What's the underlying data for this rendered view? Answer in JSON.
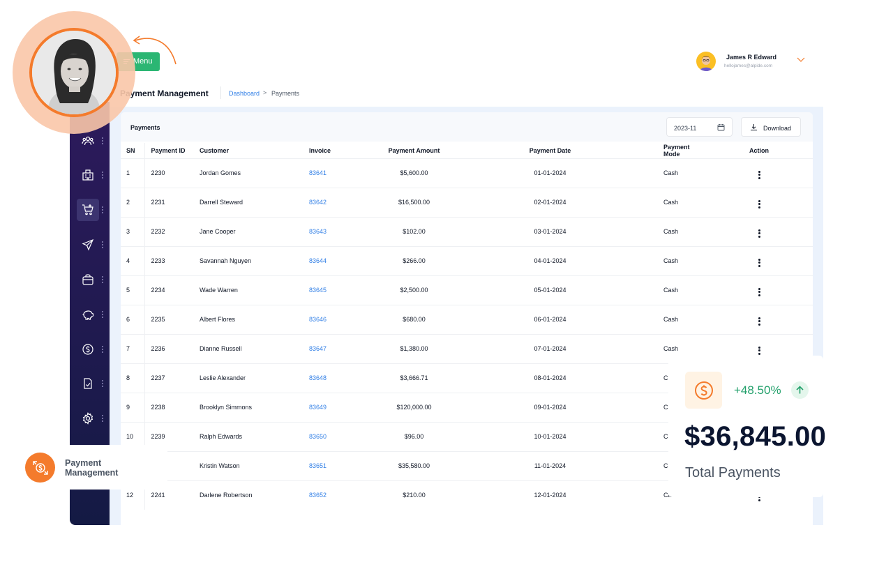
{
  "header": {
    "menu_label": "Menu",
    "page_title": "Payment Management",
    "breadcrumb": [
      "Dashboard",
      ">",
      "Payments"
    ],
    "user": {
      "name": "James R Edward",
      "email": "hellojames@alpide.com"
    }
  },
  "sidebar": {
    "items": [
      {
        "icon": "users-icon"
      },
      {
        "icon": "building-icon"
      },
      {
        "icon": "cart-icon",
        "active": true
      },
      {
        "icon": "send-icon"
      },
      {
        "icon": "bag-icon"
      },
      {
        "icon": "piggy-bank-icon"
      },
      {
        "icon": "dollar-circle-icon"
      },
      {
        "icon": "document-check-icon"
      },
      {
        "icon": "settings-icon"
      }
    ]
  },
  "payments": {
    "title": "Payments",
    "period": "2023-11",
    "download_label": "Download",
    "columns": [
      "SN",
      "Payment ID",
      "Customer",
      "Invoice",
      "Payment Amount",
      "Payment Date",
      "Payment Mode",
      "Action"
    ],
    "rows": [
      {
        "sn": "1",
        "pid": "2230",
        "customer": "Jordan Gomes",
        "invoice": "83641",
        "amount": "$5,600.00",
        "date": "01-01-2024",
        "mode": "Cash"
      },
      {
        "sn": "2",
        "pid": "2231",
        "customer": "Darrell Steward",
        "invoice": "83642",
        "amount": "$16,500.00",
        "date": "02-01-2024",
        "mode": "Cash"
      },
      {
        "sn": "3",
        "pid": "2232",
        "customer": "Jane Cooper",
        "invoice": "83643",
        "amount": "$102.00",
        "date": "03-01-2024",
        "mode": "Cash"
      },
      {
        "sn": "4",
        "pid": "2233",
        "customer": "Savannah Nguyen",
        "invoice": "83644",
        "amount": "$266.00",
        "date": "04-01-2024",
        "mode": "Cash"
      },
      {
        "sn": "5",
        "pid": "2234",
        "customer": "Wade Warren",
        "invoice": "83645",
        "amount": "$2,500.00",
        "date": "05-01-2024",
        "mode": "Cash"
      },
      {
        "sn": "6",
        "pid": "2235",
        "customer": "Albert Flores",
        "invoice": "83646",
        "amount": "$680.00",
        "date": "06-01-2024",
        "mode": "Cash"
      },
      {
        "sn": "7",
        "pid": "2236",
        "customer": "Dianne Russell",
        "invoice": "83647",
        "amount": "$1,380.00",
        "date": "07-01-2024",
        "mode": "Cash"
      },
      {
        "sn": "8",
        "pid": "2237",
        "customer": "Leslie Alexander",
        "invoice": "83648",
        "amount": "$3,666.71",
        "date": "08-01-2024",
        "mode": "Cash"
      },
      {
        "sn": "9",
        "pid": "2238",
        "customer": "Brooklyn Simmons",
        "invoice": "83649",
        "amount": "$120,000.00",
        "date": "09-01-2024",
        "mode": "Cash"
      },
      {
        "sn": "10",
        "pid": "2239",
        "customer": "Ralph Edwards",
        "invoice": "83650",
        "amount": "$96.00",
        "date": "10-01-2024",
        "mode": "Cash"
      },
      {
        "sn": "",
        "pid": "",
        "customer": "Kristin Watson",
        "invoice": "83651",
        "amount": "$35,580.00",
        "date": "11-01-2024",
        "mode": "Cash"
      },
      {
        "sn": "12",
        "pid": "2241",
        "customer": "Darlene Robertson",
        "invoice": "83652",
        "amount": "$210.00",
        "date": "12-01-2024",
        "mode": "Cash"
      }
    ]
  },
  "stat_card": {
    "change": "+48.50%",
    "value": "$36,845.00",
    "label": "Total Payments",
    "accent": "#f47b2c",
    "positive_color": "#22a06b"
  },
  "badge": {
    "line1": "Payment",
    "line2": "Management"
  },
  "colors": {
    "brand_green": "#2bb673",
    "sidebar": "#241b52",
    "link": "#2f7ee6",
    "orange": "#f47b2c"
  }
}
